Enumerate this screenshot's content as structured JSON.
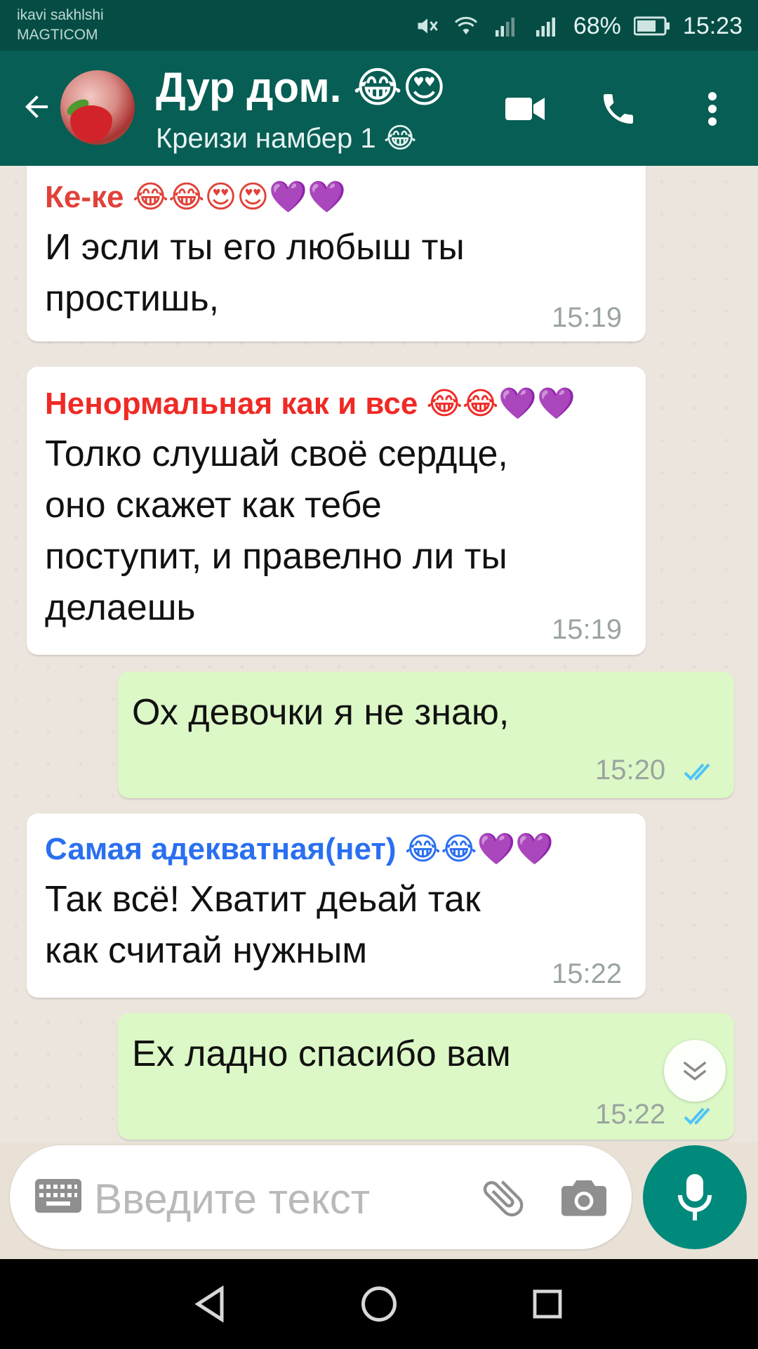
{
  "status_bar": {
    "carrier_line1": "ikavi sakhlshi",
    "carrier_line2": "MAGTICOM",
    "battery": "68%",
    "time": "15:23"
  },
  "header": {
    "title": "Дур дом. 😂😍",
    "subtitle": "Креизи намбер 1 😂"
  },
  "messages": [
    {
      "direction": "in",
      "sender": "Ке-ке 😂😂😍😍💜💜",
      "sender_color": "#e0423a",
      "lines": [
        "И эсли ты его любыш ты",
        "простишь,"
      ],
      "time": "15:19"
    },
    {
      "direction": "in",
      "sender": "Ненормальная как и все 😂😂💜💜",
      "sender_color": "#ef2a25",
      "lines": [
        "Толко слушай своё сердце,",
        "оно скажет как тебе",
        "поступит, и правелно ли ты",
        "делаешь"
      ],
      "time": "15:19"
    },
    {
      "direction": "out",
      "lines": [
        "Ох девочки я не знаю,"
      ],
      "time": "15:20"
    },
    {
      "direction": "in",
      "sender": "Самая адекватная(нет) 😂😂💜💜",
      "sender_color": "#2a6ff0",
      "lines": [
        "Так всё! Хватит деьай так",
        "как считай нужным"
      ],
      "time": "15:22"
    },
    {
      "direction": "out",
      "lines": [
        "Ех ладно спасибо вам"
      ],
      "time": "15:22"
    }
  ],
  "input": {
    "placeholder": "Введите текст"
  },
  "colors": {
    "header_bg": "#075e54",
    "status_bg": "#054d44",
    "outgoing_bubble": "#dcf8c6",
    "incoming_bubble": "#ffffff",
    "mic_button": "#008a7c",
    "read_ticks": "#4fc3f7"
  },
  "icons": [
    "back-arrow-icon",
    "video-call-icon",
    "phone-icon",
    "more-vert-icon",
    "keyboard-icon",
    "attach-icon",
    "camera-icon",
    "mic-icon",
    "chevron-down-icon",
    "nav-back-icon",
    "nav-home-icon",
    "nav-recents-icon"
  ]
}
